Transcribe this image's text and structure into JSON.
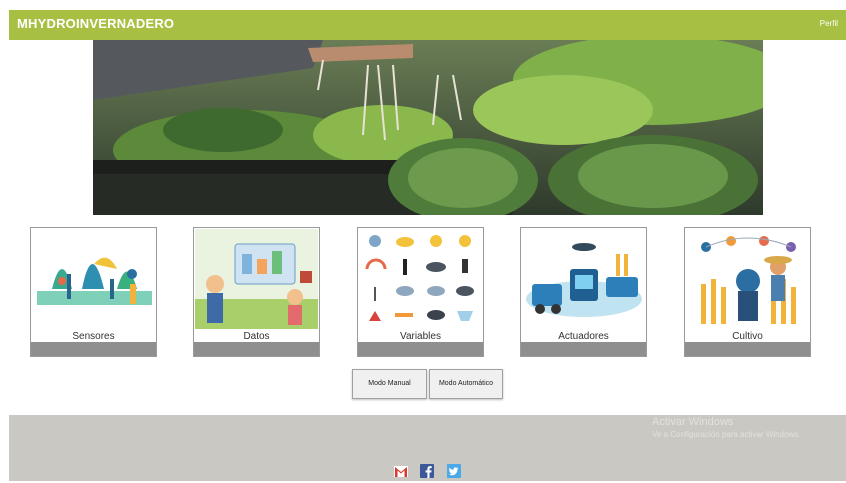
{
  "navbar": {
    "brand": "MHYDROINVERNADERO",
    "profile_link": "Perfil",
    "color": "#a7c043"
  },
  "hero": {
    "alt": "hydroponic lettuce greenhouse"
  },
  "cards": [
    {
      "label": "Sensores",
      "icon": "sensors-illustration"
    },
    {
      "label": "Datos",
      "icon": "data-illustration"
    },
    {
      "label": "Variables",
      "icon": "weather-variables-illustration"
    },
    {
      "label": "Actuadores",
      "icon": "actuators-illustration"
    },
    {
      "label": "Cultivo",
      "icon": "crop-illustration"
    }
  ],
  "buttons": {
    "manual": "Modo Manual",
    "automatic": "Modo Automático"
  },
  "watermark": {
    "title": "Activar Windows",
    "subtitle": "Ve a Configuración para activar Windows."
  },
  "footer": {
    "icons": [
      "gmail-icon",
      "facebook-icon",
      "twitter-icon"
    ],
    "color": "#cac8c2"
  }
}
